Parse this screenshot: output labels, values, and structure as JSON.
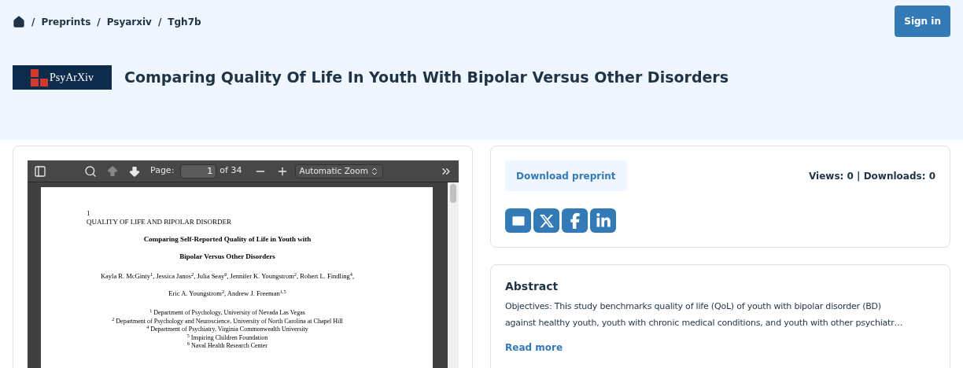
{
  "breadcrumb": {
    "separator": "/",
    "items": [
      "Preprints",
      "Psyarxiv",
      "Tgh7b"
    ]
  },
  "sign_in": "Sign in",
  "logo": {
    "text": "PsyArXiv"
  },
  "title": "Comparing Quality Of Life In Youth With Bipolar Versus Other Disorders",
  "pdf_viewer": {
    "toolbar": {
      "page_label": "Page:",
      "page_value": "1",
      "page_count": "of 34",
      "zoom": "Automatic Zoom",
      "previous_disabled": true
    },
    "page": {
      "number": "1",
      "running_head": "QUALITY OF LIFE AND BIPOLAR DISORDER",
      "title_lines": [
        "Comparing Self-Reported Quality of Life in Youth with",
        "Bipolar Versus Other Disorders"
      ],
      "author_lines": [
        "Kayla R. McGinty$^{1}$, Jessica Janos$^{2}$, Julia Seay$^{6}$, Jennifer K. Youngstrom$^{2}$, Robert L. Findling$^{4}$,",
        "Eric A. Youngstrom$^{2}$, Andrew J. Freeman$^{1,5}$"
      ],
      "affiliations": [
        "$^{1}$ Department of Psychology, University of Nevada Las Vegas",
        "$^{2}$ Department of Psychology and Neuroscience, University of North Carolina at Chapel Hill",
        "$^{4}$ Department of Psychiatry, Virginia Commonwealth University",
        "$^{5}$ Inspiring Children Foundation",
        "$^{6}$ Naval Health Research Center"
      ]
    }
  },
  "download_button": "Download preprint",
  "stats": "Views: 0 | Downloads: 0",
  "share_buttons": [
    {
      "kind": "email"
    },
    {
      "kind": "x"
    },
    {
      "kind": "facebook"
    },
    {
      "kind": "linkedin"
    }
  ],
  "abstract": {
    "heading": "Abstract",
    "lines": [
      "Objectives: This study benchmarks quality of life (QoL) of youth with bipolar disorder (BD)",
      "against healthy youth, youth with chronic medical conditions, and youth with other psychiatr…"
    ],
    "read_more": "Read more"
  }
}
